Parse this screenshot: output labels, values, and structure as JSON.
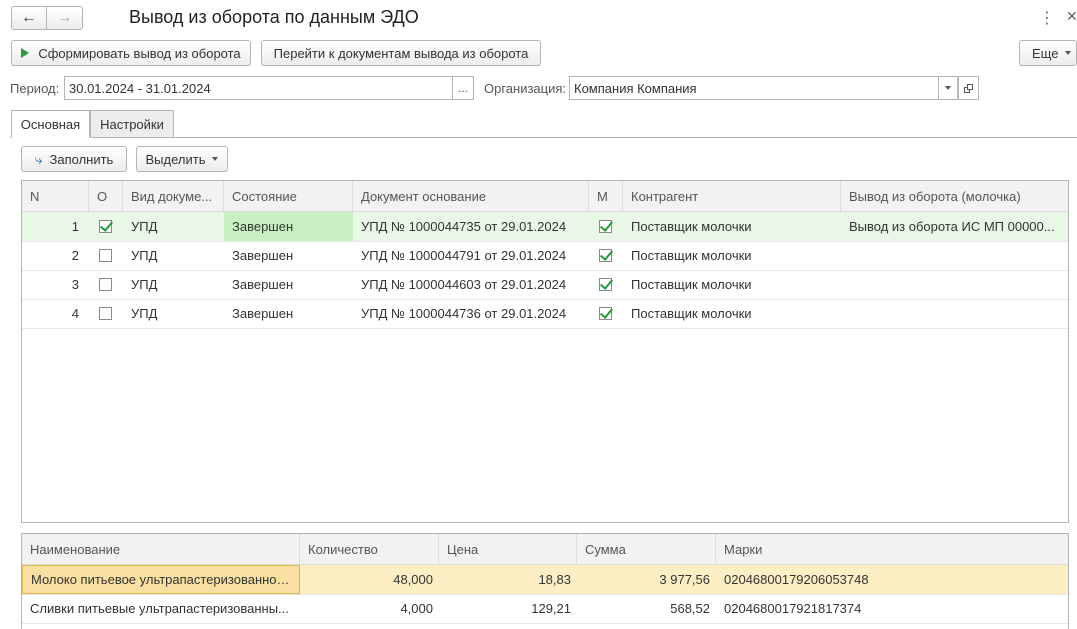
{
  "window": {
    "title": "Вывод из оборота по данным ЭДО"
  },
  "toolbar": {
    "form_label": "Сформировать вывод из оборота",
    "goto_label": "Перейти к документам вывода из оборота",
    "more_label": "Еще"
  },
  "filters": {
    "period_label": "Период:",
    "period_value": "30.01.2024 - 31.01.2024",
    "period_select": "...",
    "org_label": "Организация:",
    "org_value": "Компания Компания"
  },
  "tabs": [
    {
      "label": "Основная"
    },
    {
      "label": "Настройки"
    }
  ],
  "actions": {
    "fill_label": "Заполнить",
    "select_label": "Выделить"
  },
  "docs": {
    "columns": [
      "N",
      "О",
      "Вид докуме...",
      "Состояние",
      "Документ основание",
      "М",
      "Контрагент",
      "Вывод из оборота (молочка)"
    ],
    "rows": [
      {
        "n": "1",
        "o": true,
        "kind": "УПД",
        "state": "Завершен",
        "doc": "УПД № 1000044735 от 29.01.2024",
        "m": true,
        "partner": "Поставщик молочки",
        "output": "Вывод из оборота ИС МП 00000..."
      },
      {
        "n": "2",
        "o": false,
        "kind": "УПД",
        "state": "Завершен",
        "doc": "УПД № 1000044791 от 29.01.2024",
        "m": true,
        "partner": "Поставщик молочки",
        "output": ""
      },
      {
        "n": "3",
        "o": false,
        "kind": "УПД",
        "state": "Завершен",
        "doc": "УПД № 1000044603 от 29.01.2024",
        "m": true,
        "partner": "Поставщик молочки",
        "output": ""
      },
      {
        "n": "4",
        "o": false,
        "kind": "УПД",
        "state": "Завершен",
        "doc": "УПД № 1000044736 от 29.01.2024",
        "m": true,
        "partner": "Поставщик молочки",
        "output": ""
      }
    ]
  },
  "goods": {
    "columns": [
      "Наименование",
      "Количество",
      "Цена",
      "Сумма",
      "Марки"
    ],
    "rows": [
      {
        "name": "Молоко питьевое ультрапастеризованное...",
        "qty": "48,000",
        "price": "18,83",
        "sum": "3 977,56",
        "marks": "0204680017920605374​8"
      },
      {
        "name": "Сливки питьевые ультрапастеризованны...",
        "qty": "4,000",
        "price": "129,21",
        "sum": "568,52",
        "marks": "0204680017921817374"
      }
    ]
  },
  "colors": {
    "selected_row": "#e8f7e6",
    "state_cell": "#c9f0c2",
    "goods_selected": "#fdefc3",
    "goods_selected_cell": "#f9e0a0"
  },
  "icons": {
    "back": "arrow-left-icon",
    "forward": "arrow-right-icon",
    "play": "play-icon",
    "fill": "fill-arrow-icon"
  }
}
